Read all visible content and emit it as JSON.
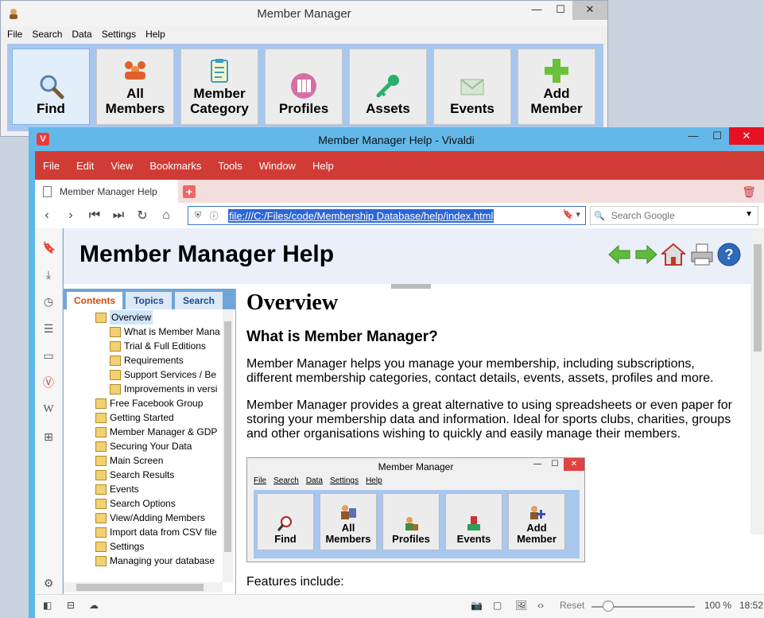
{
  "bg_app": {
    "title": "Member Manager",
    "menu": [
      "File",
      "Search",
      "Data",
      "Settings",
      "Help"
    ],
    "toolbar": [
      {
        "label": "Find",
        "icon": "magnifier-icon"
      },
      {
        "label": "All Members",
        "icon": "people-icon"
      },
      {
        "label": "Member Category",
        "icon": "clipboard-icon"
      },
      {
        "label": "Profiles",
        "icon": "binders-icon"
      },
      {
        "label": "Assets",
        "icon": "key-icon"
      },
      {
        "label": "Events",
        "icon": "envelope-icon"
      },
      {
        "label": "Add Member",
        "icon": "plus-icon"
      }
    ],
    "controls": {
      "min": "—",
      "max": "☐",
      "close": "✕"
    }
  },
  "browser": {
    "title": "Member Manager Help - Vivaldi",
    "logo": "V",
    "menu": [
      "File",
      "Edit",
      "View",
      "Bookmarks",
      "Tools",
      "Window",
      "Help"
    ],
    "tab_label": "Member Manager Help",
    "url": "file:///C:/Files/code/Membership Database/help/index.html",
    "search_placeholder": "Search Google",
    "controls": {
      "min": "—",
      "max": "☐",
      "close": "✕"
    },
    "status": {
      "reset": "Reset",
      "zoom": "100 %",
      "time": "18:52"
    }
  },
  "help": {
    "header_title": "Member Manager Help",
    "tabs": [
      "Contents",
      "Topics",
      "Search"
    ],
    "tree": [
      {
        "label": "Overview",
        "level": 0,
        "selected": true
      },
      {
        "label": "What is Member Mana",
        "level": 1
      },
      {
        "label": "Trial & Full Editions",
        "level": 1
      },
      {
        "label": "Requirements",
        "level": 1
      },
      {
        "label": "Support Services / Be",
        "level": 1
      },
      {
        "label": "Improvements in versi",
        "level": 1
      },
      {
        "label": "Free Facebook Group",
        "level": 0
      },
      {
        "label": "Getting Started",
        "level": 0
      },
      {
        "label": "Member Manager & GDP",
        "level": 0
      },
      {
        "label": "Securing Your Data",
        "level": 0
      },
      {
        "label": "Main Screen",
        "level": 0
      },
      {
        "label": "Search Results",
        "level": 0
      },
      {
        "label": "Events",
        "level": 0
      },
      {
        "label": "Search Options",
        "level": 0
      },
      {
        "label": "View/Adding Members",
        "level": 0
      },
      {
        "label": "Import data from CSV file",
        "level": 0
      },
      {
        "label": "Settings",
        "level": 0
      },
      {
        "label": "Managing your database",
        "level": 0
      }
    ],
    "h1": "Overview",
    "h2": "What is Member Manager?",
    "p1": "Member Manager helps you manage your membership, including subscriptions, different membership categories, contact details, events, assets, profiles and more.",
    "p2": "Member Manager provides a great alternative to using spreadsheets or even paper for storing your membership data and information. Ideal for sports clubs, charities, groups and other organisations wishing to quickly and easily manage their members.",
    "features": "Features include:",
    "mini": {
      "title": "Member Manager",
      "menu": [
        "File",
        "Search",
        "Data",
        "Settings",
        "Help"
      ],
      "toolbar": [
        {
          "label": "Find",
          "icon": "magnifier-icon"
        },
        {
          "label": "All Members",
          "icon": "people-icon"
        },
        {
          "label": "Profiles",
          "icon": "profile-icon"
        },
        {
          "label": "Events",
          "icon": "event-icon"
        },
        {
          "label": "Add Member",
          "icon": "add-person-icon"
        }
      ],
      "controls": {
        "min": "—",
        "max": "☐",
        "close": "✕"
      }
    }
  },
  "colors": {
    "vivaldi_red": "#d13b35",
    "title_blue": "#64b8e9",
    "toolbar_blue": "#a8c7ef"
  }
}
